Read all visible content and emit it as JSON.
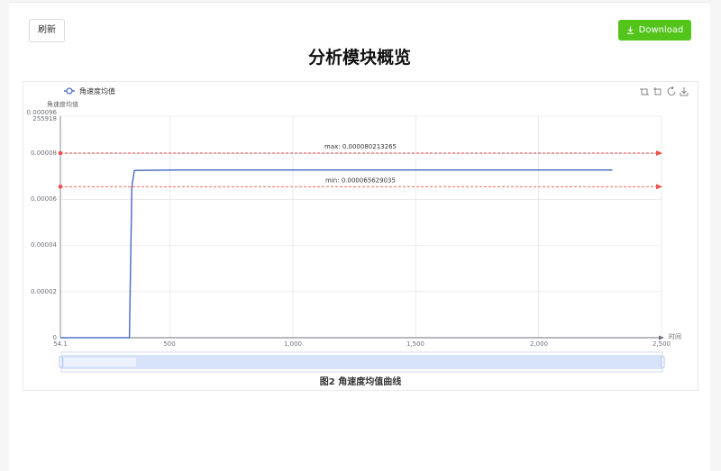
{
  "toolbar": {
    "refresh_label": "刷新",
    "download_label": "Download"
  },
  "page": {
    "title": "分析模块概览"
  },
  "chart_caption": "图2 角速度均值曲线",
  "colors": {
    "download": "#52c41a",
    "series": "#5470c6",
    "markline": "#ee4f4f"
  },
  "chart_data": {
    "type": "line",
    "legend": [
      "角速度均值"
    ],
    "legend_position": "top-left",
    "ylabel": "角速度均值",
    "xlabel": "时间",
    "x_tick_labels": [
      "54.1",
      "500",
      "1,000",
      "1,500",
      "2,000",
      "2,500"
    ],
    "y_tick_labels": [
      "0",
      "0.00002",
      "0.00004",
      "0.00006",
      "0.00008",
      "0.000096255918"
    ],
    "xlim": [
      54.1,
      2500
    ],
    "ylim": [
      0,
      9.6255918e-05
    ],
    "grid": true,
    "series": [
      {
        "name": "角速度均值",
        "x": [
          54.1,
          335,
          345,
          355,
          540,
          2300
        ],
        "y": [
          0,
          0,
          6.5629035e-05,
          7.27e-05,
          7.29e-05,
          7.29e-05
        ]
      }
    ],
    "mark_lines": [
      {
        "label": "max: 0.000080213265",
        "value": 8.0213265e-05
      },
      {
        "label": "min: 0.000065629035",
        "value": 6.5629035e-05
      }
    ],
    "toolbox_icons": [
      "zoom-icon",
      "zoom-reset-icon",
      "restore-icon",
      "save-image-icon"
    ],
    "data_zoom_range": [
      0,
      1
    ]
  }
}
